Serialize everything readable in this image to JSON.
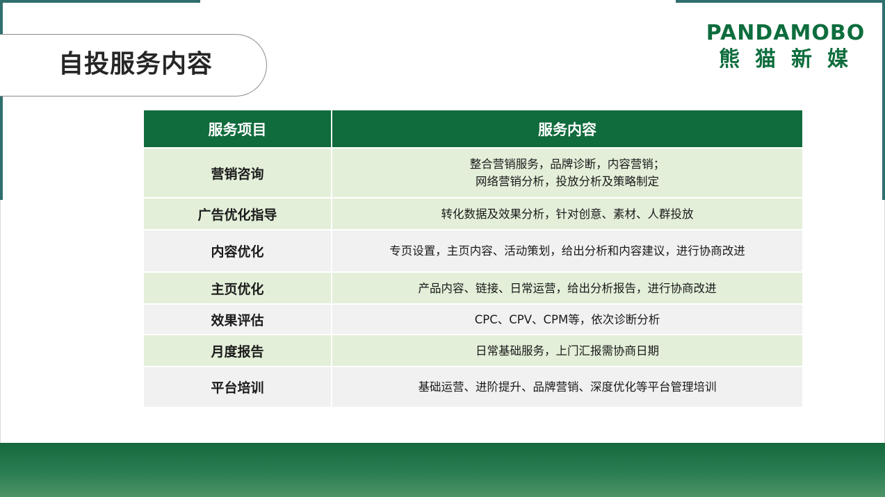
{
  "page": {
    "title": "自投服务内容"
  },
  "logo": {
    "english": "PANDAMOBO",
    "chinese": "熊猫新媒",
    "color": "#0e6d3d"
  },
  "colors": {
    "header_green": "#106b3d",
    "row_green": "#e3efd9",
    "row_grey": "#f1f1f1",
    "frame_teal": "#2f6f6e"
  },
  "table": {
    "headers": [
      "服务项目",
      "服务内容"
    ],
    "rows": [
      {
        "item": "营销咨询",
        "content": [
          "整合营销服务，品牌诊断，内容营销；",
          "网络营销分析，投放分析及策略制定"
        ]
      },
      {
        "item": "广告优化指导",
        "content": [
          "转化数据及效果分析，针对创意、素材、人群投放"
        ]
      },
      {
        "item": "内容优化",
        "content": [
          "专页设置，主页内容、活动策划，给出分析和内容建议，进行协商改进"
        ]
      },
      {
        "item": "主页优化",
        "content": [
          "产品内容、链接、日常运营，给出分析报告，进行协商改进"
        ]
      },
      {
        "item": "效果评估",
        "content": [
          "CPC、CPV、CPM等，依次诊断分析"
        ]
      },
      {
        "item": "月度报告",
        "content": [
          "日常基础服务，上门汇报需协商日期"
        ]
      },
      {
        "item": "平台培训",
        "content": [
          "基础运营、进阶提升、品牌营销、深度优化等平台管理培训"
        ]
      }
    ]
  }
}
